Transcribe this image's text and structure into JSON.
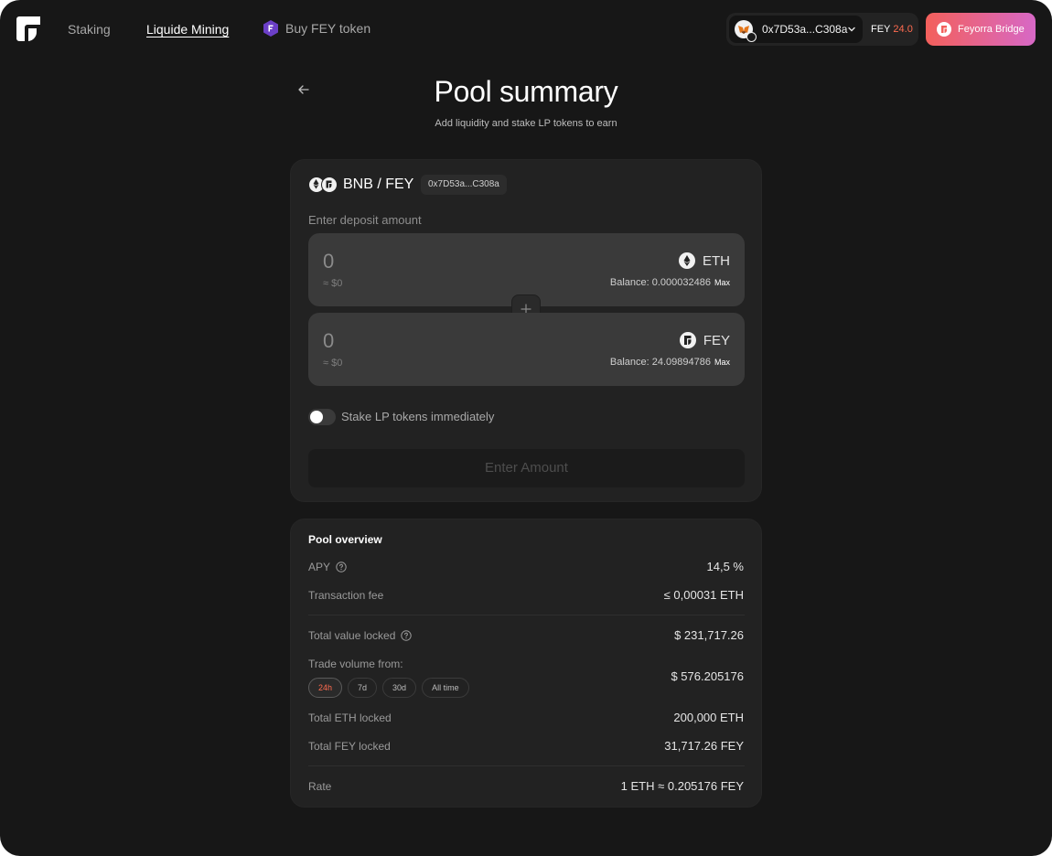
{
  "nav": {
    "staking": "Staking",
    "liquid_mining": "Liquide Mining",
    "buy_fey": "Buy FEY token"
  },
  "wallet": {
    "address": "0x7D53a...C308a",
    "fey_label": "FEY",
    "fey_balance": "24.0"
  },
  "bridge": {
    "label": "Feyorra Bridge"
  },
  "header": {
    "title": "Pool summary",
    "subtitle": "Add liquidity and stake LP tokens to earn"
  },
  "deposit": {
    "pair": "BNB / FEY",
    "pair_address": "0x7D53a...C308a",
    "label": "Enter deposit amount",
    "eth": {
      "amount": "0",
      "usd": "≈ $0",
      "token": "ETH",
      "balance_label": "Balance: ",
      "balance": "0.000032486",
      "max": "Max"
    },
    "fey": {
      "amount": "0",
      "usd": "≈ $0",
      "token": "FEY",
      "balance_label": "Balance: ",
      "balance": "24.09894786",
      "max": "Max"
    },
    "stake_toggle_label": "Stake LP tokens immediately",
    "stake_toggle_on": false,
    "submit_label": "Enter Amount"
  },
  "overview": {
    "title": "Pool overview",
    "apy_label": "APY",
    "apy_value": "14,5  %",
    "fee_label": "Transaction fee",
    "fee_value": "≤ 0,00031  ETH",
    "tvl_label": "Total value locked",
    "tvl_value": "$  231,717.26",
    "volume_label": "Trade volume from:",
    "volume_value": "$  576.205176",
    "volume_ranges": [
      "24h",
      "7d",
      "30d",
      "All time"
    ],
    "volume_range_selected": "24h",
    "eth_locked_label": "Total ETH locked",
    "eth_locked_value": "200,000  ETH",
    "fey_locked_label": "Total FEY locked",
    "fey_locked_value": "31,717.26  FEY",
    "rate_label": "Rate",
    "rate_value": "1 ETH ≈  0.205176 FEY"
  },
  "colors": {
    "background": "#171717",
    "card": "#222222",
    "input": "#3a3a3a",
    "accent": "#ff6b4f",
    "bridge_gradient_start": "#f3605b",
    "bridge_gradient_end": "#d768c6"
  }
}
